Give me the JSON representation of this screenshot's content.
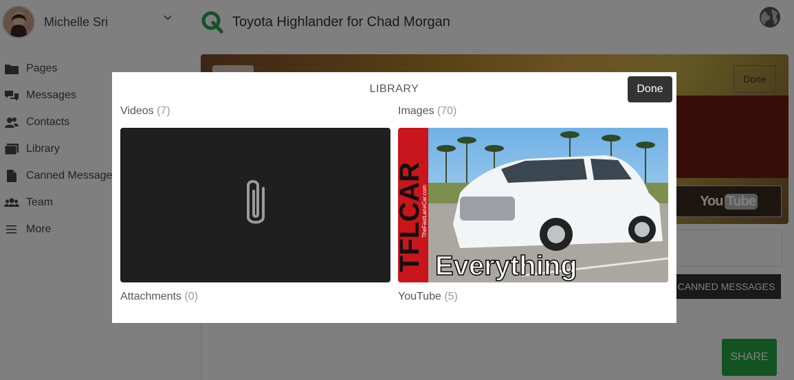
{
  "user": {
    "name": "Michelle Sri"
  },
  "nav": [
    {
      "label": "Pages",
      "icon": "folder-icon"
    },
    {
      "label": "Messages",
      "icon": "chat-icon"
    },
    {
      "label": "Contacts",
      "icon": "contacts-icon"
    },
    {
      "label": "Library",
      "icon": "library-icon"
    },
    {
      "label": "Canned Messages",
      "icon": "document-icon"
    },
    {
      "label": "Team",
      "icon": "team-icon"
    },
    {
      "label": "More",
      "icon": "menu-icon"
    }
  ],
  "header": {
    "title": "Toyota Highlander for Chad Morgan"
  },
  "background": {
    "done_label": "Done",
    "youtube_you": "You",
    "youtube_tube": "Tube",
    "canned_label": "CANNED MESSAGES",
    "share_label": "SHARE"
  },
  "modal": {
    "title": "LIBRARY",
    "done_label": "Done",
    "videos": {
      "label": "Videos",
      "count": "(7)"
    },
    "images": {
      "label": "Images",
      "count": "(70)"
    },
    "attachments": {
      "label": "Attachments",
      "count": "(0)"
    },
    "youtube": {
      "label": "YouTube",
      "count": "(5)"
    },
    "image_overlay": {
      "brand": "TFLCAR",
      "site": "TheFastLaneCar.com",
      "caption": "Everything"
    }
  },
  "colors": {
    "accent_green": "#27a745",
    "dark_button": "#333333",
    "logo_green": "#2e9e57"
  }
}
